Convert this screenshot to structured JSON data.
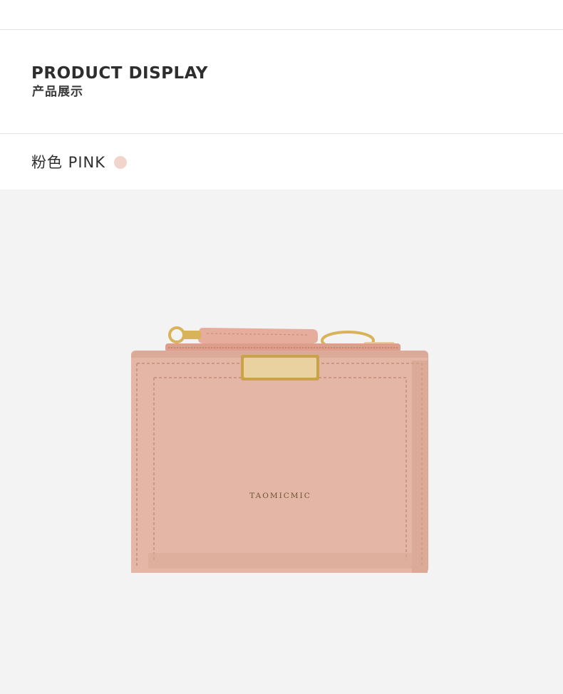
{
  "header": {
    "title_en": "PRODUCT DISPLAY",
    "title_cn": "产品展示"
  },
  "color_option": {
    "label": "粉色 PINK",
    "swatch_color": "#f1d5cc"
  },
  "product": {
    "brand_plate_text": "TAOMICMIC",
    "body_color": "#e3b6a6",
    "hardware_color": "#d8b35a"
  }
}
